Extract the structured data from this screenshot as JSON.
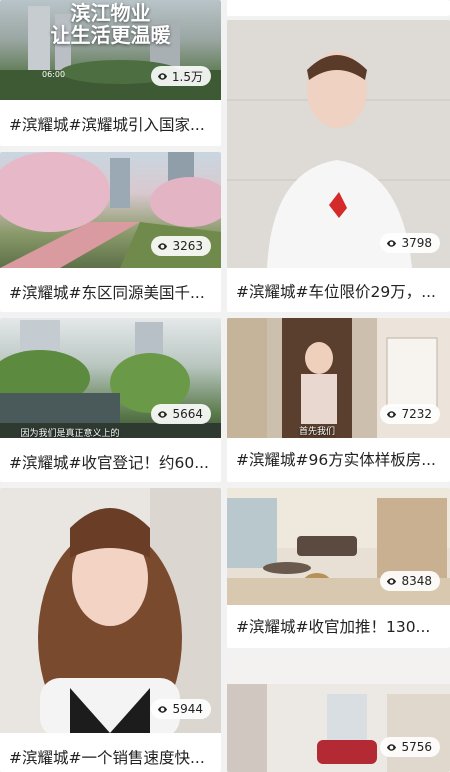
{
  "feed": {
    "left": [
      {
        "title": "#滨耀城#滨耀城引入国家...",
        "views": "1.5万",
        "overlay_line1": "滨江物业",
        "overlay_line2": "让生活更温暖",
        "time": "06:00"
      },
      {
        "title": "#滨耀城#东区同源美国千...",
        "views": "3263"
      },
      {
        "title": "#滨耀城#收官登记！约60...",
        "views": "5664",
        "subtitle": "因为我们是真正意义上的"
      },
      {
        "title": "#滨耀城#一个销售速度快...",
        "views": "5944"
      }
    ],
    "right": [
      {
        "title": "#滨耀城#车位限价29万，...",
        "views": "3798"
      },
      {
        "title": "#滨耀城#96方实体样板房...",
        "views": "7232",
        "subtitle": "首先我们"
      },
      {
        "title": "#滨耀城#收官加推！130...",
        "views": "8348"
      },
      {
        "views": "5756"
      }
    ]
  },
  "colors": {
    "background": "#f2f2f2",
    "card": "#ffffff",
    "text": "#222222",
    "badge": "#ffffff"
  },
  "icons": {
    "views": "eye-icon"
  }
}
